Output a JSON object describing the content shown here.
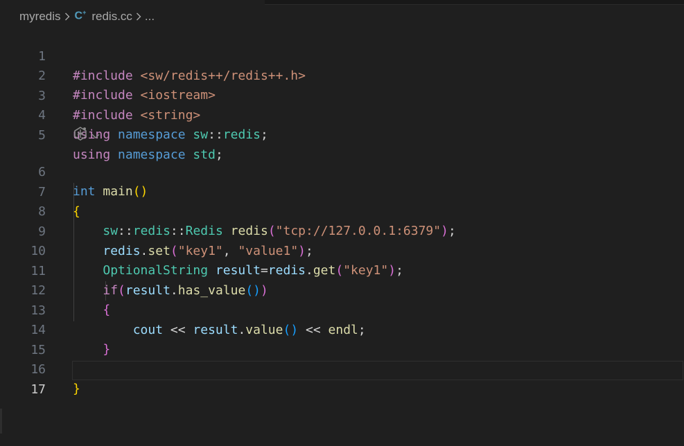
{
  "breadcrumb": {
    "folder": "myredis",
    "file_icon": "C++",
    "file": "redis.cc",
    "more": "..."
  },
  "editor": {
    "line_numbers": [
      "1",
      "2",
      "3",
      "4",
      "5",
      "6",
      "7",
      "8",
      "9",
      "10",
      "11",
      "12",
      "13",
      "14",
      "15",
      "16",
      "17"
    ],
    "active_line": "17",
    "codelens_icon": "copilot-sparkle-icon",
    "lines": {
      "l1": {
        "t1": "#include ",
        "t2": "<sw/redis++/redis++.h>"
      },
      "l2": {
        "t1": "#include ",
        "t2": "<iostream>"
      },
      "l3": {
        "t1": "#include ",
        "t2": "<string>"
      },
      "l4": {
        "t1": "using",
        "t2": " ",
        "t3": "namespace",
        "t4": " ",
        "t5": "sw",
        "t6": "::",
        "t7": "redis",
        "t8": ";"
      },
      "l5": {
        "t1": "using",
        "t2": " ",
        "t3": "namespace",
        "t4": " ",
        "t5": "std",
        "t6": ";"
      },
      "l6": {
        "t1": "int",
        "t2": " ",
        "t3": "main",
        "t4": "()"
      },
      "l7": {
        "t1": "{"
      },
      "l8": {
        "t1": "sw",
        "t2": "::",
        "t3": "redis",
        "t4": "::",
        "t5": "Redis",
        "t6": " ",
        "t7": "redis",
        "t8": "(",
        "t9": "\"tcp://127.0.0.1:6379\"",
        "t10": ")",
        "t11": ";"
      },
      "l9": {
        "t1": "redis",
        "t2": ".",
        "t3": "set",
        "t4": "(",
        "t5": "\"key1\"",
        "t6": ", ",
        "t7": "\"value1\"",
        "t8": ")",
        "t9": ";"
      },
      "l10": {
        "t1": "OptionalString",
        "t2": " ",
        "t3": "result",
        "t4": "=",
        "t5": "redis",
        "t6": ".",
        "t7": "get",
        "t8": "(",
        "t9": "\"key1\"",
        "t10": ")",
        "t11": ";"
      },
      "l11": {
        "t1": "if",
        "t2": "(",
        "t3": "result",
        "t4": ".",
        "t5": "has_value",
        "t6": "()",
        "t7": ")"
      },
      "l12": {
        "t1": "{"
      },
      "l13": {
        "t1": "cout",
        "t2": " << ",
        "t3": "result",
        "t4": ".",
        "t5": "value",
        "t6": "()",
        "t7": " << ",
        "t8": "endl",
        "t9": ";"
      },
      "l14": {
        "t1": "}"
      },
      "l16": {
        "t1": "}"
      }
    }
  },
  "colors": {
    "background": "#1f1f1f",
    "keyword": "#569cd6",
    "control": "#c586c0",
    "type": "#4ec9b0",
    "variable": "#9cdcfe",
    "function": "#dcdcaa",
    "string": "#ce9178",
    "bracket_gold": "#ffd700",
    "bracket_orchid": "#da70d6",
    "bracket_blue": "#179fff"
  }
}
